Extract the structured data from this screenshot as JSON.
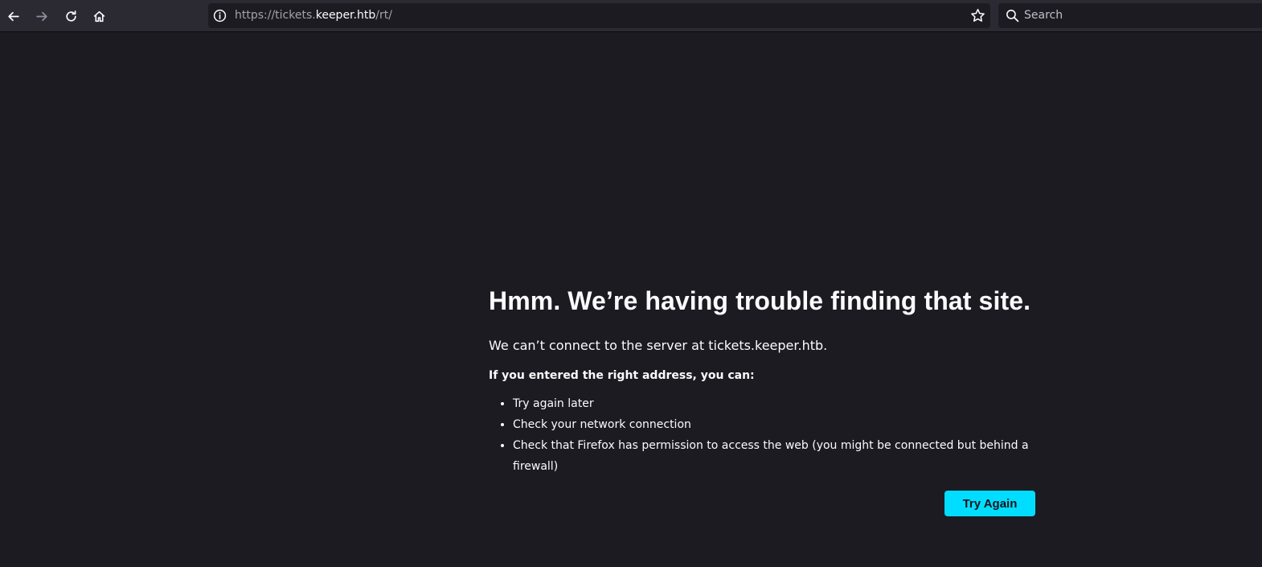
{
  "browser": {
    "toolbar": {
      "back_icon": "arrow-left-icon",
      "forward_icon": "arrow-right-icon",
      "reload_icon": "reload-icon",
      "home_icon": "home-icon"
    },
    "urlbar": {
      "scheme_prefix": "https://tickets.",
      "host": "keeper.htb",
      "path": "/rt/",
      "info_icon": "info-icon",
      "bookmark_icon": "star-icon"
    },
    "search": {
      "placeholder": "Search",
      "icon": "search-icon"
    }
  },
  "error_page": {
    "title": "Hmm. We’re having trouble finding that site.",
    "description": "We can’t connect to the server at tickets.keeper.htb.",
    "subheading": "If you entered the right address, you can:",
    "suggestions": [
      "Try again later",
      "Check your network connection",
      "Check that Firefox has permission to access the web (you might be connected but behind a firewall)"
    ],
    "try_again_label": "Try Again"
  },
  "colors": {
    "background": "#1c1b22",
    "toolbar": "#2b2a33",
    "accent_button": "#00ddff"
  }
}
